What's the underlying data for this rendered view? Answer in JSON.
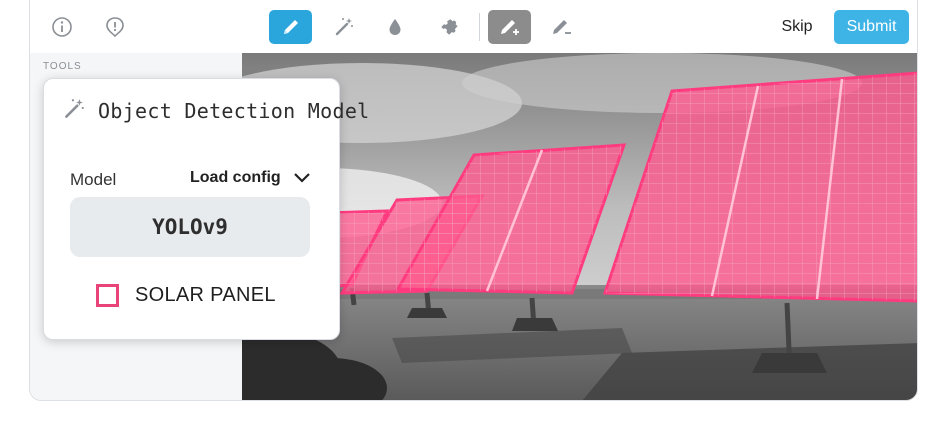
{
  "toolbar": {
    "left_icons": [
      "info-icon",
      "alert-icon"
    ],
    "tools": [
      {
        "name": "pencil-tool",
        "icon": "pencil-icon",
        "state": "active"
      },
      {
        "name": "magic-wand-tool",
        "icon": "magic-wand-icon",
        "state": "normal"
      },
      {
        "name": "droplet-tool",
        "icon": "droplet-icon",
        "state": "normal"
      },
      {
        "name": "puzzle-tool",
        "icon": "puzzle-icon",
        "state": "normal"
      },
      {
        "name": "pencil-plus-tool",
        "icon": "pencil-plus-icon",
        "state": "selected"
      },
      {
        "name": "pencil-minus-tool",
        "icon": "pencil-minus-icon",
        "state": "normal"
      }
    ],
    "skip_label": "Skip",
    "submit_label": "Submit"
  },
  "sidebar": {
    "section_label": "TOOLS"
  },
  "popup": {
    "title": "Object Detection Model",
    "icon": "magic-wand-icon",
    "model_label": "Model",
    "load_config_label": "Load config",
    "model_value": "YOLOv9",
    "labels": [
      {
        "text": "SOLAR PANEL",
        "color": "#e8447a",
        "checked": false
      }
    ]
  },
  "canvas": {
    "image_subject": "solar-panel-array",
    "annotation_color": "#ff3b7f"
  },
  "colors": {
    "accent": "#2aa6dc",
    "submit": "#3eb3e6",
    "selected_tool": "#8c8c8c",
    "annotation": "#ff3b7f"
  }
}
